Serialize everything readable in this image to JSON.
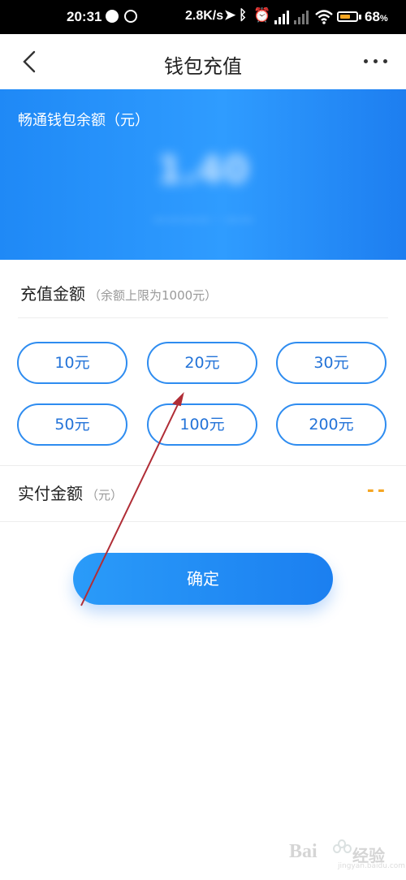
{
  "status_bar": {
    "time": "20:31",
    "net_speed": "2.8K/s",
    "battery_percent": "68",
    "battery_pct_sign": "%",
    "battery_level": 0.68
  },
  "header": {
    "title": "钱包充值"
  },
  "balance": {
    "label": "畅通钱包余额（元）",
    "amount": "1.40",
    "sub": "———— · ——"
  },
  "recharge": {
    "title": "充值金额",
    "note": "（余额上限为1000元）",
    "options": [
      "10元",
      "20元",
      "30元",
      "50元",
      "100元",
      "200元"
    ]
  },
  "pay": {
    "title": "实付金额",
    "unit": "（元）",
    "value": "--"
  },
  "confirm_label": "确定",
  "watermark": {
    "brand": "Bai",
    "brand_cn": "经验",
    "url": "jingyan.baidu.com"
  },
  "colors": {
    "accent": "#2e8cf0",
    "card_blue": "#2f9cff",
    "pay_value": "#f5a623",
    "annotation_arrow": "#b02d36"
  }
}
